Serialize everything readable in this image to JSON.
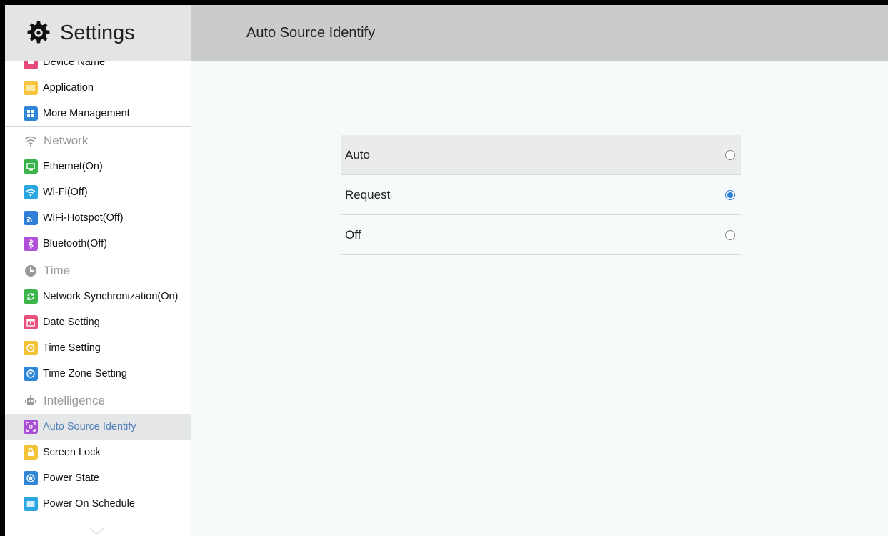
{
  "header": {
    "app_title": "Settings",
    "page_title": "Auto Source Identify"
  },
  "sidebar": {
    "items": [
      {
        "label": "Device Name",
        "icon": "device-name-icon",
        "color": "#e64a7b"
      },
      {
        "label": "Application",
        "icon": "application-icon",
        "color": "#f5c542"
      },
      {
        "label": "More Management",
        "icon": "more-management-icon",
        "color": "#2f86d6"
      },
      {
        "group": "Network",
        "icon": "wifi-icon"
      },
      {
        "label": "Ethernet(On)",
        "icon": "ethernet-icon",
        "color": "#37b34a"
      },
      {
        "label": "Wi-Fi(Off)",
        "icon": "wifi-icon",
        "color": "#2aa6e0"
      },
      {
        "label": "WiFi-Hotspot(Off)",
        "icon": "hotspot-icon",
        "color": "#2f7ed8"
      },
      {
        "label": "Bluetooth(Off)",
        "icon": "bluetooth-icon",
        "color": "#b04fd8"
      },
      {
        "group": "Time",
        "icon": "clock-icon"
      },
      {
        "label": "Network Synchronization(On)",
        "icon": "sync-icon",
        "color": "#3cb54a"
      },
      {
        "label": "Date Setting",
        "icon": "calendar-icon",
        "color": "#e8527a"
      },
      {
        "label": "Time Setting",
        "icon": "clock-icon",
        "color": "#f2c237"
      },
      {
        "label": "Time Zone Setting",
        "icon": "location-icon",
        "color": "#2f86d6"
      },
      {
        "group": "Intelligence",
        "icon": "robot-icon"
      },
      {
        "label": "Auto Source Identify",
        "icon": "source-identify-icon",
        "color": "#a94fd6",
        "active": true
      },
      {
        "label": "Screen Lock",
        "icon": "lock-icon",
        "color": "#f2c237"
      },
      {
        "label": "Power State",
        "icon": "power-state-icon",
        "color": "#2f86d6"
      },
      {
        "label": "Power On Schedule",
        "icon": "schedule-icon",
        "color": "#2aa6e0"
      }
    ]
  },
  "options": [
    {
      "label": "Auto",
      "selected": false
    },
    {
      "label": "Request",
      "selected": true
    },
    {
      "label": "Off",
      "selected": false
    }
  ],
  "colors": {
    "accent": "#2d7fd7",
    "active_text": "#4f7fb8"
  }
}
